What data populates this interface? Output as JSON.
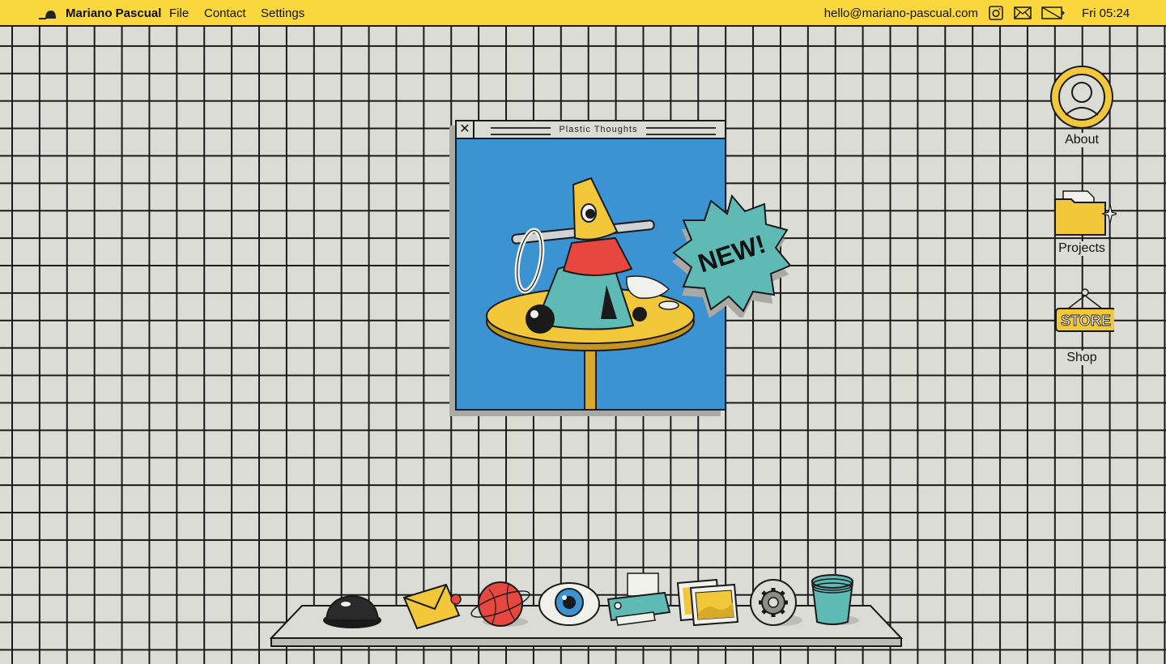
{
  "menubar": {
    "logo_icon": "computer-mouse-icon",
    "brand": "Mariano Pascual",
    "menus": [
      "File",
      "Contact",
      "Settings"
    ],
    "email": "hello@mariano-pascual.com",
    "status_icons": [
      "instagram-icon",
      "mail-icon",
      "battery-icon"
    ],
    "clock": "Fri 05:24"
  },
  "window": {
    "title": "Plastic Thoughts",
    "close_glyph": "✕",
    "badge_text": "NEW!"
  },
  "desktop_icons": [
    {
      "label": "About",
      "icon": "avatar-icon"
    },
    {
      "label": "Projects",
      "icon": "folder-icon"
    },
    {
      "label": "Shop",
      "icon": "store-sign-icon",
      "sign_text": "STORE"
    }
  ],
  "dock": {
    "items": [
      "dome-icon",
      "envelope-icon",
      "planet-icon",
      "eye-icon",
      "printer-icon",
      "photos-icon",
      "gear-icon",
      "trash-bucket-icon"
    ]
  },
  "colors": {
    "accent_yellow": "#fbd73e",
    "window_blue": "#3b93d2",
    "teal": "#5fbab6",
    "red": "#e8473f",
    "grid_bg": "#dcdcd6"
  }
}
